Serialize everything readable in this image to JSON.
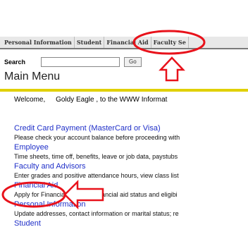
{
  "tabs": [
    "Personal Information",
    "Student",
    "Financial Aid",
    "Faculty Se"
  ],
  "search": {
    "label": "Search",
    "button": "Go"
  },
  "page_title": "Main Menu",
  "welcome": {
    "text": "Welcome,",
    "name": "Goldy Eagle",
    "rest": ", to the WWW Informat"
  },
  "menu": [
    {
      "label": "Credit Card Payment (MasterCard or Visa)",
      "desc": "Please check your account balance before proceeding with"
    },
    {
      "label": "Employee",
      "desc": "Time sheets, time off, benefits, leave or job data, paystubs"
    },
    {
      "label": "Faculty and Advisors",
      "desc": "Enter grades and positive attendance hours, view class list"
    },
    {
      "label": "Financial Aid",
      "desc": "Apply for Financial Aid, view financial aid status and eligibi"
    },
    {
      "label": "Personal Information",
      "desc": "Update addresses, contact information or marital status; re"
    },
    {
      "label": "Student",
      "desc": ""
    }
  ],
  "colors": {
    "link": "#1f2fc8",
    "annotation": "#e8121b",
    "rule": "#e0d000"
  }
}
